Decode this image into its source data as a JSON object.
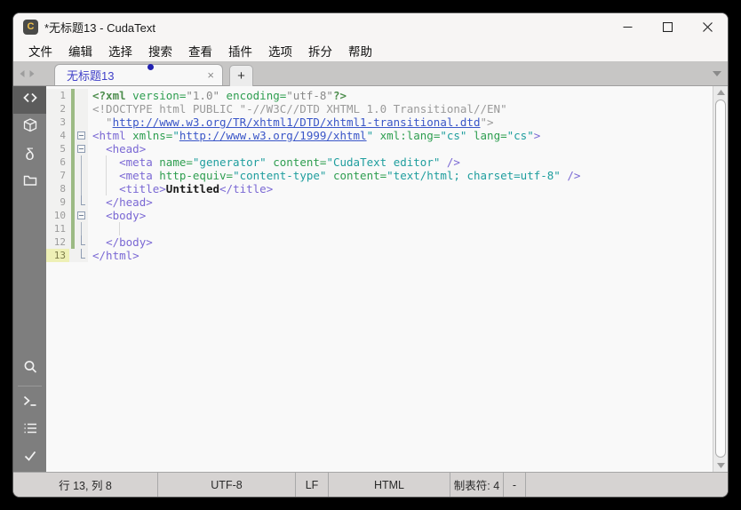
{
  "window": {
    "title": "*无标题13 - CudaText",
    "app_icon_letter": "C"
  },
  "icons": {
    "minimize": "minimize-icon",
    "maximize": "maximize-icon",
    "close": "close-icon",
    "tab_close": "×",
    "new_tab": "+",
    "tab_menu": "▾",
    "nav_left": "◂",
    "nav_right": "▸"
  },
  "menu": {
    "items": [
      {
        "id": "file",
        "label": "文件"
      },
      {
        "id": "edit",
        "label": "编辑"
      },
      {
        "id": "selection",
        "label": "选择"
      },
      {
        "id": "search",
        "label": "搜索"
      },
      {
        "id": "view",
        "label": "查看"
      },
      {
        "id": "plugins",
        "label": "插件"
      },
      {
        "id": "options",
        "label": "选项"
      },
      {
        "id": "split",
        "label": "拆分"
      },
      {
        "id": "help",
        "label": "帮助"
      }
    ]
  },
  "tabbar": {
    "active_tab": {
      "label": "无标题13",
      "modified": true
    }
  },
  "sidebar": {
    "top_items": [
      {
        "id": "code-tree",
        "icon": "code-tree-icon",
        "active": true
      },
      {
        "id": "project",
        "icon": "package-icon",
        "active": false
      },
      {
        "id": "snippets",
        "icon": "delta-icon",
        "active": false
      },
      {
        "id": "tabs-panel",
        "icon": "folder-icon",
        "active": false
      }
    ],
    "bottom_items": [
      {
        "id": "search",
        "icon": "search-icon",
        "divider_after": true
      },
      {
        "id": "console",
        "icon": "terminal-icon"
      },
      {
        "id": "output",
        "icon": "list-icon"
      },
      {
        "id": "validate",
        "icon": "check-icon"
      }
    ]
  },
  "editor": {
    "lines": [
      {
        "n": 1,
        "fold": "",
        "mod": true,
        "guides": [],
        "t": [
          [
            "pi",
            "<?xml "
          ],
          [
            "attr",
            "version="
          ],
          [
            "mut",
            "\"1.0\""
          ],
          [
            "attr",
            " encoding="
          ],
          [
            "mut",
            "\"utf-8\""
          ],
          [
            "pi",
            "?>"
          ]
        ]
      },
      {
        "n": 2,
        "fold": "",
        "mod": true,
        "guides": [],
        "t": [
          [
            "cm",
            "<!DOCTYPE html PUBLIC \"-//W3C//DTD XHTML 1.0 Transitional//EN\""
          ]
        ]
      },
      {
        "n": 3,
        "fold": "",
        "mod": true,
        "guides": [],
        "t": [
          [
            "cm",
            "  \""
          ],
          [
            "url",
            "http://www.w3.org/TR/xhtml1/DTD/xhtml1-transitional.dtd"
          ],
          [
            "cm",
            "\">"
          ]
        ]
      },
      {
        "n": 4,
        "fold": "box",
        "mod": true,
        "guides": [],
        "t": [
          [
            "tag",
            "<html "
          ],
          [
            "attr",
            "xmlns="
          ],
          [
            "val",
            "\""
          ],
          [
            "url",
            "http://www.w3.org/1999/xhtml"
          ],
          [
            "val",
            "\""
          ],
          [
            "attr",
            " xml:lang="
          ],
          [
            "val",
            "\"cs\""
          ],
          [
            "attr",
            " lang="
          ],
          [
            "val",
            "\"cs\""
          ],
          [
            "tag",
            ">"
          ]
        ]
      },
      {
        "n": 5,
        "fold": "box",
        "mod": true,
        "guides": [],
        "t": [
          [
            "pln",
            "  "
          ],
          [
            "tag",
            "<head>"
          ]
        ]
      },
      {
        "n": 6,
        "fold": "line",
        "mod": true,
        "guides": [
          2
        ],
        "t": [
          [
            "pln",
            "    "
          ],
          [
            "tag",
            "<meta "
          ],
          [
            "attr",
            "name="
          ],
          [
            "val",
            "\"generator\""
          ],
          [
            "attr",
            " content="
          ],
          [
            "val",
            "\"CudaText editor\""
          ],
          [
            "tag",
            " />"
          ]
        ]
      },
      {
        "n": 7,
        "fold": "line",
        "mod": true,
        "guides": [
          2
        ],
        "t": [
          [
            "pln",
            "    "
          ],
          [
            "tag",
            "<meta "
          ],
          [
            "attr",
            "http-equiv="
          ],
          [
            "val",
            "\"content-type\""
          ],
          [
            "attr",
            " content="
          ],
          [
            "val",
            "\"text/html; charset=utf-8\""
          ],
          [
            "tag",
            " />"
          ]
        ]
      },
      {
        "n": 8,
        "fold": "line",
        "mod": true,
        "guides": [
          2
        ],
        "t": [
          [
            "pln",
            "    "
          ],
          [
            "tag",
            "<title>"
          ],
          [
            "txt",
            "Untitled"
          ],
          [
            "tag",
            "</title>"
          ]
        ]
      },
      {
        "n": 9,
        "fold": "end",
        "mod": true,
        "guides": [],
        "t": [
          [
            "pln",
            "  "
          ],
          [
            "tag",
            "</head>"
          ]
        ]
      },
      {
        "n": 10,
        "fold": "box",
        "mod": true,
        "guides": [],
        "t": [
          [
            "pln",
            "  "
          ],
          [
            "tag",
            "<body>"
          ]
        ]
      },
      {
        "n": 11,
        "fold": "line",
        "mod": true,
        "guides": [
          4
        ],
        "t": [
          [
            "pln",
            ""
          ]
        ]
      },
      {
        "n": 12,
        "fold": "end",
        "mod": true,
        "guides": [],
        "t": [
          [
            "pln",
            "  "
          ],
          [
            "tag",
            "</body>"
          ]
        ]
      },
      {
        "n": 13,
        "fold": "end",
        "mod": false,
        "current": true,
        "guides": [],
        "t": [
          [
            "tag",
            "</html>"
          ]
        ]
      }
    ]
  },
  "statusbar": {
    "cells": [
      {
        "id": "caret-pos",
        "label": "行 13, 列 8"
      },
      {
        "id": "encoding",
        "label": "UTF-8"
      },
      {
        "id": "line-ends",
        "label": "LF"
      },
      {
        "id": "lexer",
        "label": "HTML"
      },
      {
        "id": "tab-size",
        "label": "制表符: 4"
      },
      {
        "id": "insert-mode",
        "label": "-"
      }
    ]
  },
  "colors": {
    "accent_tab_text": "#4040c8",
    "modified_dot": "#2222b0",
    "modified_gutter_bar": "#9cba84",
    "current_line_number_bg": "#eef0b6",
    "tag": "#7a68d4",
    "attribute": "#2e9e50",
    "value": "#1f9e9e",
    "url": "#3a56c8",
    "comment": "#9a9a9a"
  }
}
